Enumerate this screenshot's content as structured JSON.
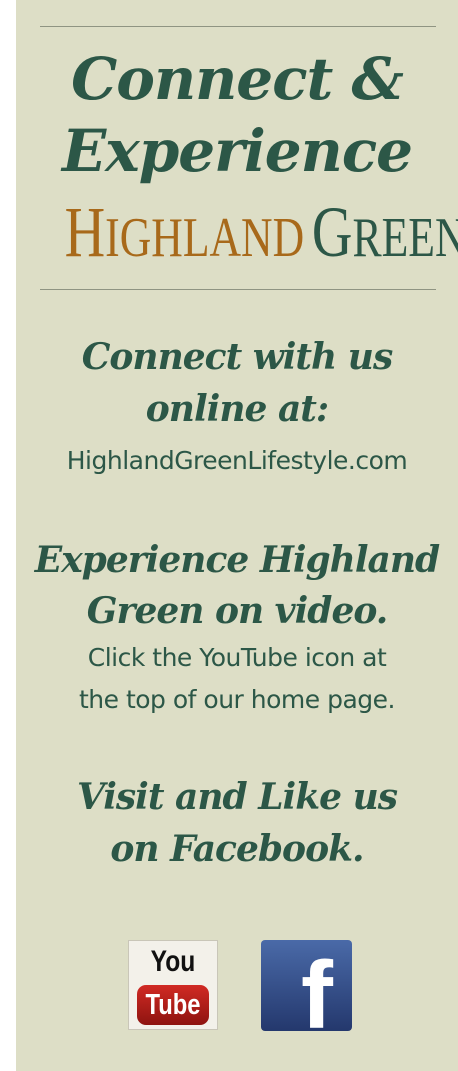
{
  "header": {
    "title_line1": "Connect &",
    "title_line2": "Experience",
    "brand": {
      "highland_initial": "H",
      "highland_rest": "IGHLAND",
      "green_initial": "G",
      "green_rest": "REEN"
    }
  },
  "sections": {
    "online": {
      "heading_line1": "Connect with us",
      "heading_line2": "online at:",
      "link": "HighlandGreenLifestyle.com"
    },
    "video": {
      "heading_line1": "Experience Highland",
      "heading_line2": "Green on video.",
      "text_line1": "Click the YouTube icon at",
      "text_line2": "the top of our home page."
    },
    "facebook": {
      "heading_line1": "Visit and Like us",
      "heading_line2": "on Facebook."
    }
  },
  "icons": {
    "youtube": {
      "name": "youtube-icon",
      "you": "You",
      "tube": "Tube"
    },
    "facebook": {
      "name": "facebook-icon",
      "glyph": "f"
    }
  },
  "colors": {
    "background": "#dddec6",
    "dark_green": "#2c5747",
    "gold": "#a8691a"
  }
}
